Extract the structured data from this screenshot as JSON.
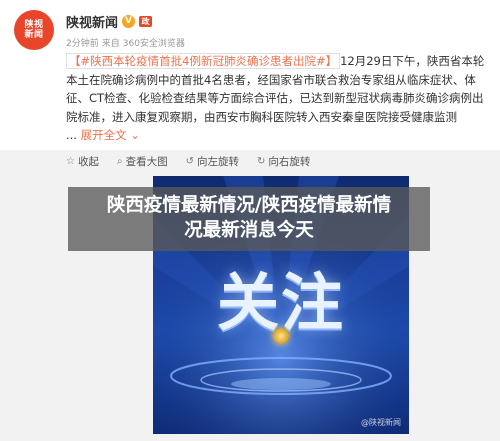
{
  "post": {
    "avatar_text": "陕视新闻",
    "author": "陕视新闻",
    "verified_badge": "V",
    "gov_badge": "政",
    "meta": {
      "time": "2分钟前",
      "source_prefix": "来自",
      "source": "360安全浏览器"
    },
    "topic": "【#陕西本轮疫情首批4例新冠肺炎确诊患者出院#】",
    "text": "12月29日下午，陕西省本轮本土在院确诊病例中的首批4名患者，经国家省市联合救治专家组从临床症状、体征、CT检查、化验检查结果等方面综合评估，已达到新型冠状病毒肺炎确诊病例出院标准，进入康复观察期，由西安市胸科医院转入西安秦皇医院接受健康监测",
    "ellipsis": "...",
    "expand_label": "展开全文",
    "expand_icon": "chevron-down-icon"
  },
  "actions": [
    {
      "icon": "bookmark-icon",
      "glyph": "☆",
      "label": "收起"
    },
    {
      "icon": "search-icon",
      "glyph": "⌕",
      "label": "查看大图"
    },
    {
      "icon": "rotate-left-icon",
      "glyph": "↺",
      "label": "向左旋转"
    },
    {
      "icon": "rotate-right-icon",
      "glyph": "↻",
      "label": "向右旋转"
    }
  ],
  "image": {
    "headline": "关注",
    "watermark": "@陕视新闻"
  },
  "overlay_title": {
    "line1": "陕西疫情最新情况/陕西疫情最新情",
    "line2": "况最新消息今天"
  },
  "colors": {
    "accent": "#eb7350",
    "avatar": "#e8452a",
    "image_blue": "#1a3f9a"
  }
}
